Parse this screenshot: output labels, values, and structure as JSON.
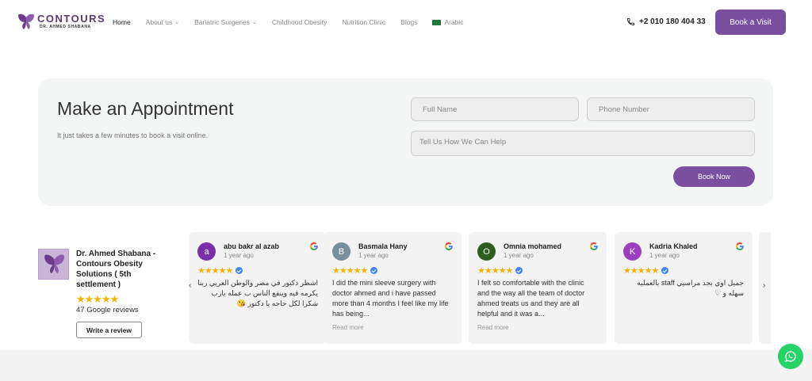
{
  "nav": {
    "logo_title": "CONTOURS",
    "logo_subtitle": "DR. AHMED SHABANA",
    "items": [
      {
        "label": "Home",
        "active": true,
        "dropdown": false
      },
      {
        "label": "About us",
        "active": false,
        "dropdown": true
      },
      {
        "label": "Bariatric Surgeries",
        "active": false,
        "dropdown": true
      },
      {
        "label": "Childhood Obesity",
        "active": false,
        "dropdown": false
      },
      {
        "label": "Nutrition Clinic",
        "active": false,
        "dropdown": false
      },
      {
        "label": "Blogs",
        "active": false,
        "dropdown": false
      },
      {
        "label": "Arabic",
        "active": false,
        "dropdown": false,
        "icon": "saudi-flag-icon"
      }
    ],
    "phone": "+2 010 180 404 33",
    "book_visit_label": "Book a Visit"
  },
  "appointment": {
    "title": "Make an Appointment",
    "subtitle": "It just takes a few minutes to book a visit online.",
    "full_name_placeholder": "Full Name",
    "phone_placeholder": "Phone Number",
    "help_placeholder": "Tell Us How We Can Help",
    "submit_label": "Book Now"
  },
  "reviews_summary": {
    "name": "Dr. Ahmed Shabana - Contours Obesity Solutions ( 5th settlement )",
    "stars": "★★★★★",
    "count_text": "47 Google reviews",
    "write_label": "Write a review"
  },
  "reviews": [
    {
      "initial": "a",
      "color": "#7a2fa8",
      "name": "abu bakr al azab",
      "time": "1 year ago",
      "stars": "★★★★★",
      "rtl": true,
      "text": "اشطر دكتور في مصر والوطن العربي ربنا يكرمه فيه وينفع الناس ب عمله يارب شكرا لكل حاجه يا دكتور 😘",
      "more": ""
    },
    {
      "initial": "B",
      "color": "#78909c",
      "name": "Basmala Hany",
      "time": "1 year ago",
      "stars": "★★★★★",
      "rtl": false,
      "text": "I did the mini sleeve surgery with doctor ahmed and i have passed more than 4 months I feel like my life has being...",
      "more": "Read more"
    },
    {
      "initial": "O",
      "color": "#2e5e1e",
      "name": "Omnia mohamed",
      "time": "1 year ago",
      "stars": "★★★★★",
      "rtl": false,
      "text": "I felt so comfortable with the clinic and the way all the team of doctor ahmed treats us and they are all helpful and it was a...",
      "more": "Read more"
    },
    {
      "initial": "K",
      "color": "#9c3fbf",
      "name": "Kadria Khaled",
      "time": "1 year ago",
      "stars": "★★★★★",
      "rtl": true,
      "text": "جميل اوي بجد مراسيي staff بالعمليه سهله و ♡",
      "more": ""
    }
  ],
  "colors": {
    "brand": "#7b4fa0",
    "star": "#f5b400",
    "whatsapp": "#25d366"
  }
}
